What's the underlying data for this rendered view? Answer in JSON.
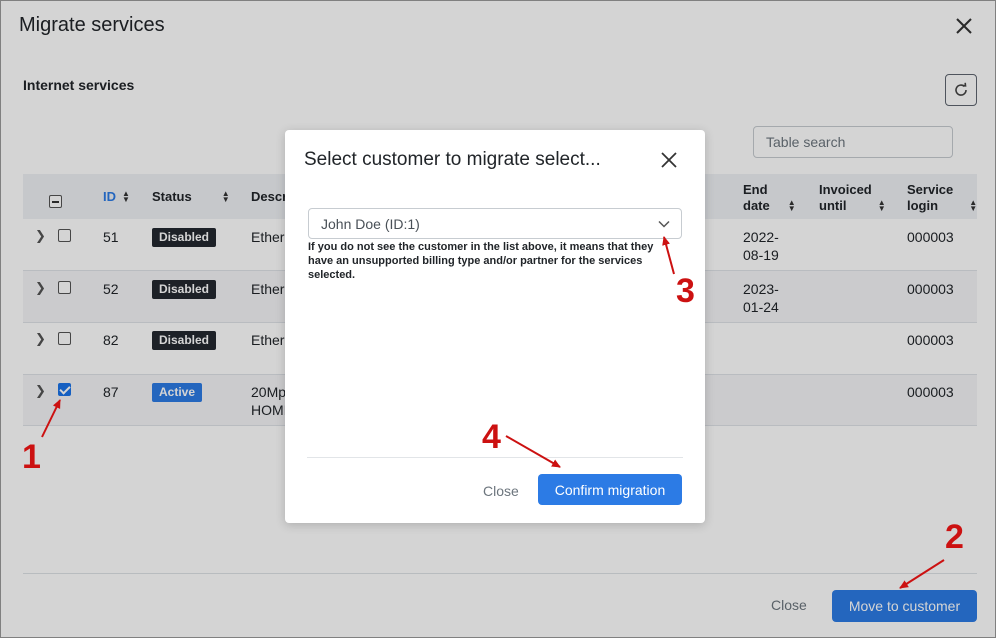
{
  "outer": {
    "title": "Migrate services",
    "section_title": "Internet services",
    "search_placeholder": "Table search",
    "close_label": "Close",
    "move_label": "Move to customer"
  },
  "table": {
    "headers": {
      "id": "ID",
      "status": "Status",
      "description": "Descr",
      "end_date_1": "End",
      "end_date_2": "date",
      "invoiced_1": "Invoiced",
      "invoiced_2": "until",
      "login_1": "Service",
      "login_2": "login"
    },
    "rows": [
      {
        "id": "51",
        "status": "Disabled",
        "desc_1": "Ether",
        "desc_2": "",
        "end_1": "2022-",
        "end_2": "08-19",
        "login": "000003",
        "checked": false
      },
      {
        "id": "52",
        "status": "Disabled",
        "desc_1": "Ether",
        "desc_2": "",
        "end_1": "2023-",
        "end_2": "01-24",
        "login": "000003",
        "checked": false
      },
      {
        "id": "82",
        "status": "Disabled",
        "desc_1": "Ether",
        "desc_2": "",
        "end_1": "",
        "end_2": "",
        "login": "000003",
        "checked": false
      },
      {
        "id": "87",
        "status": "Active",
        "desc_1": "20Mp",
        "desc_2": "HOMI",
        "end_1": "",
        "end_2": "",
        "login": "000003",
        "checked": true
      }
    ]
  },
  "dialog": {
    "title": "Select customer to migrate select...",
    "selected_customer": "John Doe (ID:1)",
    "hint": "If you do not see the customer in the list above, it means that they have an unsupported billing type and/or partner for the services selected.",
    "close_label": "Close",
    "confirm_label": "Confirm migration"
  },
  "annotations": [
    "1",
    "2",
    "3",
    "4"
  ],
  "colors": {
    "accent": "#2c7be5",
    "disabled_badge": "#232830",
    "annotation": "#cc1111"
  }
}
